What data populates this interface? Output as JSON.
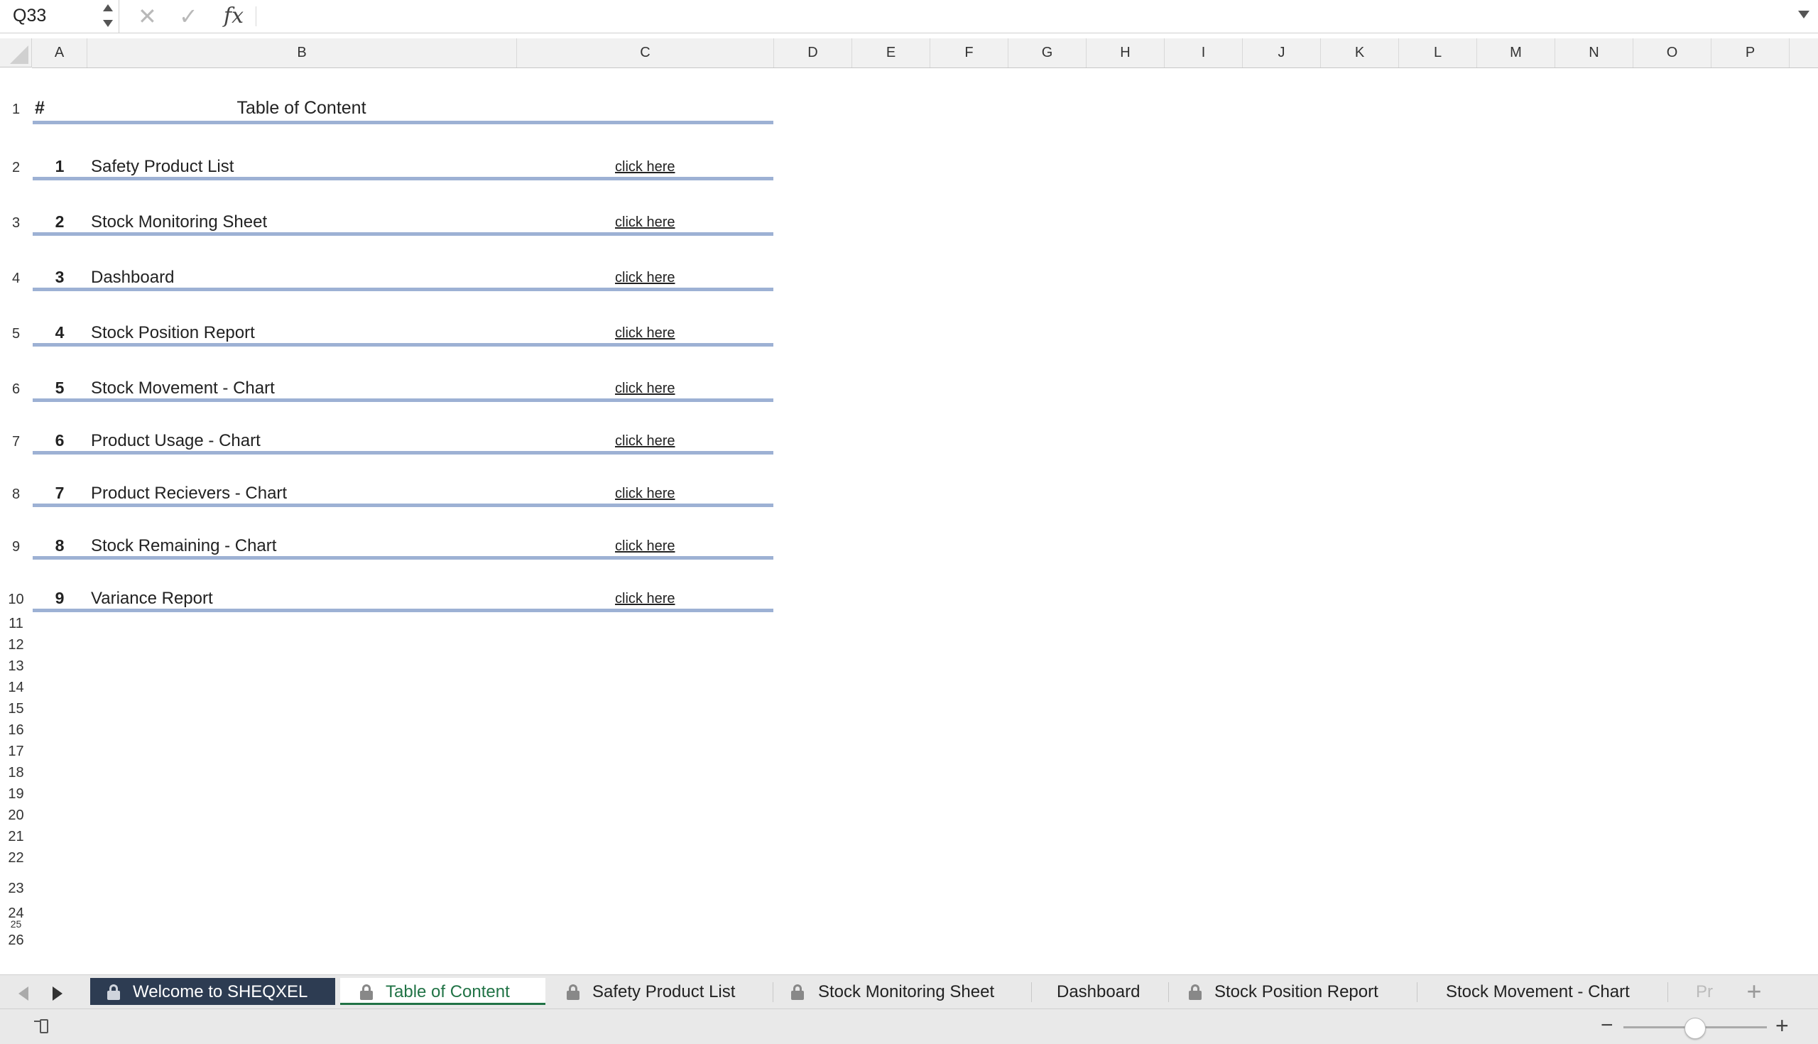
{
  "formula_bar": {
    "name_box": "Q33",
    "fx": "fx",
    "formula_value": ""
  },
  "columns": [
    "A",
    "B",
    "C",
    "D",
    "E",
    "F",
    "G",
    "H",
    "I",
    "J",
    "K",
    "L",
    "M",
    "N",
    "O",
    "P"
  ],
  "rows": [
    "1",
    "2",
    "3",
    "4",
    "5",
    "6",
    "7",
    "8",
    "9",
    "10",
    "11",
    "12",
    "13",
    "14",
    "15",
    "16",
    "17",
    "18",
    "19",
    "20",
    "21",
    "22",
    "23",
    "24",
    "25",
    "26"
  ],
  "toc": {
    "hash": "#",
    "title": "Table of Content",
    "link_text": "click here",
    "items": [
      {
        "num": "1",
        "label": "Safety Product List"
      },
      {
        "num": "2",
        "label": "Stock Monitoring Sheet"
      },
      {
        "num": "3",
        "label": "Dashboard"
      },
      {
        "num": "4",
        "label": "Stock Position Report"
      },
      {
        "num": "5",
        "label": "Stock Movement - Chart"
      },
      {
        "num": "6",
        "label": "Product Usage - Chart"
      },
      {
        "num": "7",
        "label": "Product Recievers - Chart"
      },
      {
        "num": "8",
        "label": "Stock Remaining - Chart"
      },
      {
        "num": "9",
        "label": "Variance Report"
      }
    ]
  },
  "tabs": [
    {
      "label": "Welcome to SHEQXEL",
      "locked": true,
      "state": "dark"
    },
    {
      "label": "Table of Content",
      "locked": true,
      "state": "active"
    },
    {
      "label": "Safety Product List",
      "locked": true
    },
    {
      "label": "Stock Monitoring Sheet",
      "locked": true
    },
    {
      "label": "Dashboard",
      "locked": false
    },
    {
      "label": "Stock Position Report",
      "locked": true
    },
    {
      "label": "Stock Movement - Chart",
      "locked": false
    },
    {
      "label": "Pr",
      "locked": false
    }
  ],
  "add_sheet": "+",
  "status": {
    "zoom_out": "−",
    "zoom_in": "+",
    "accent": "#217346"
  }
}
